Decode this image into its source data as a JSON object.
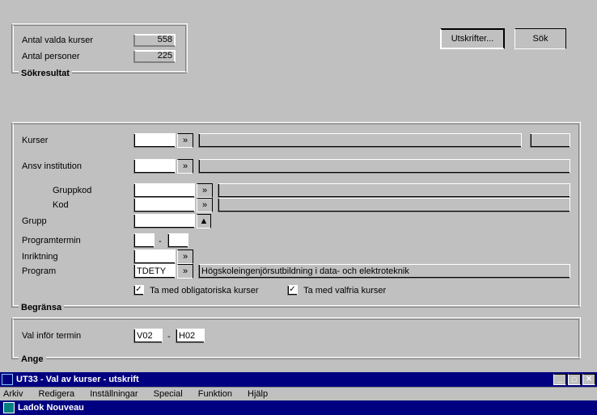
{
  "app_title": "Ladok Nouveau",
  "menu": {
    "arkiv": "Arkiv",
    "redigera": "Redigera",
    "installningar": "Inställningar",
    "special": "Special",
    "funktion": "Funktion",
    "hjalp": "Hjälp"
  },
  "doc_title": "UT33 - Val av kurser - utskrift",
  "ange": {
    "legend": "Ange",
    "val_infor_termin": "Val inför termin",
    "term_from": "V02",
    "term_to": "H02",
    "dash": "-"
  },
  "begransa": {
    "legend": "Begränsa",
    "cb_oblig": "Ta med obligatoriska kurser",
    "cb_valfria": "Ta med valfria kurser",
    "program": "Program",
    "program_val": "TDETY",
    "program_desc": "Högskoleingenjörsutbildning i data- och elektroteknik",
    "inriktning": "Inriktning",
    "programtermin": "Programtermin",
    "prog_dash": "-",
    "grupp": "Grupp",
    "kod": "Kod",
    "gruppkod": "Gruppkod",
    "ansv_institution": "Ansv institution",
    "kurser": "Kurser"
  },
  "sokresultat": {
    "legend": "Sökresultat",
    "antal_personer": "Antal personer",
    "antal_personer_val": "225",
    "antal_valda": "Antal valda kurser",
    "antal_valda_val": "558"
  },
  "buttons": {
    "utskrifter": "Utskrifter...",
    "sok": "Sök"
  },
  "glyph": {
    "rangle": "»",
    "updown": "▲",
    "check": "✓",
    "min": "_",
    "max": "□",
    "close": "✕"
  }
}
